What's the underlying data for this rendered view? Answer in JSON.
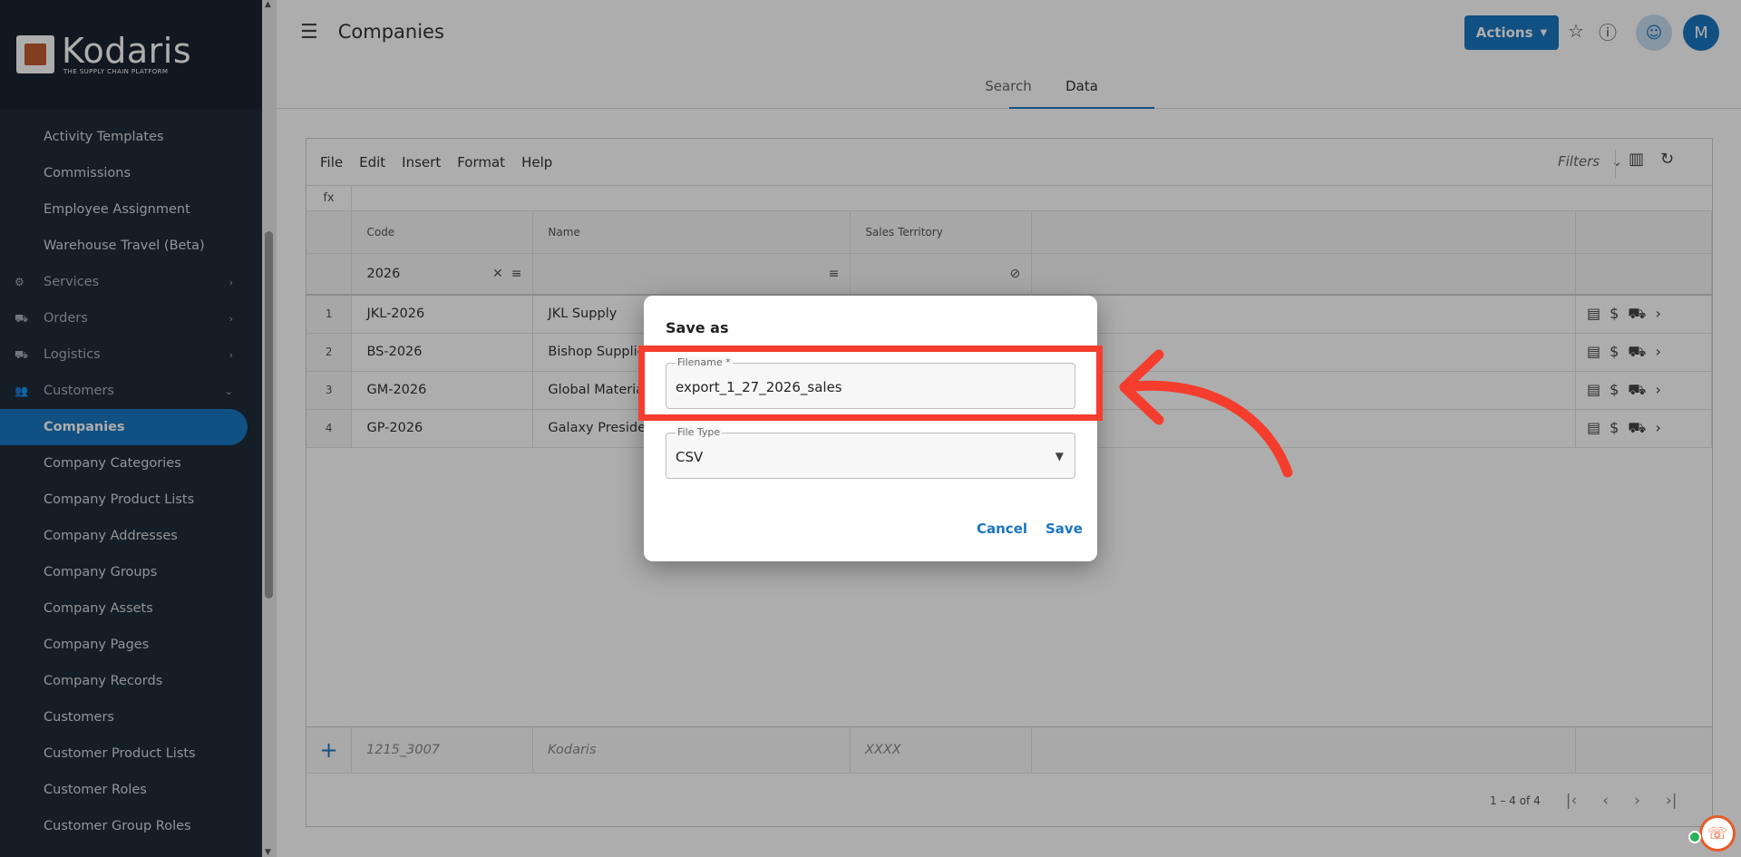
{
  "brand": {
    "name": "Kodaris",
    "tagline": "THE SUPPLY CHAIN PLATFORM"
  },
  "sidebar": {
    "items": [
      {
        "label": "Activity Templates",
        "type": "link"
      },
      {
        "label": "Commissions",
        "type": "link"
      },
      {
        "label": "Employee Assignment",
        "type": "link"
      },
      {
        "label": "Warehouse Travel (Beta)",
        "type": "link"
      },
      {
        "label": "Services",
        "type": "group",
        "icon": "gears-icon",
        "expanded": false
      },
      {
        "label": "Orders",
        "type": "group",
        "icon": "truck-icon",
        "expanded": false
      },
      {
        "label": "Logistics",
        "type": "group",
        "icon": "delivery-icon",
        "expanded": false
      },
      {
        "label": "Customers",
        "type": "group",
        "icon": "people-icon",
        "expanded": true
      },
      {
        "label": "Companies",
        "type": "link",
        "active": true
      },
      {
        "label": "Company Categories",
        "type": "link"
      },
      {
        "label": "Company Product Lists",
        "type": "link"
      },
      {
        "label": "Company Addresses",
        "type": "link"
      },
      {
        "label": "Company Groups",
        "type": "link"
      },
      {
        "label": "Company Assets",
        "type": "link"
      },
      {
        "label": "Company Pages",
        "type": "link"
      },
      {
        "label": "Company Records",
        "type": "link"
      },
      {
        "label": "Customers",
        "type": "link"
      },
      {
        "label": "Customer Product Lists",
        "type": "link"
      },
      {
        "label": "Customer Roles",
        "type": "link"
      },
      {
        "label": "Customer Group Roles",
        "type": "link"
      }
    ]
  },
  "header": {
    "title": "Companies",
    "actions_label": "Actions",
    "avatar_initial": "M"
  },
  "tabs": [
    {
      "label": "Search"
    },
    {
      "label": "Data",
      "active": true
    }
  ],
  "sheet": {
    "menu": [
      "File",
      "Edit",
      "Insert",
      "Format",
      "Help"
    ],
    "filters_label": "Filters",
    "fx_label": "fx",
    "columns": {
      "code": "Code",
      "name": "Name",
      "territory": "Sales Territory"
    },
    "filter_code": "2026",
    "rows": [
      {
        "n": "1",
        "code": "JKL-2026",
        "name": "JKL Supply"
      },
      {
        "n": "2",
        "code": "BS-2026",
        "name": "Bishop Supplies"
      },
      {
        "n": "3",
        "code": "GM-2026",
        "name": "Global Materials"
      },
      {
        "n": "4",
        "code": "GP-2026",
        "name": "Galaxy President"
      }
    ],
    "new_row": {
      "code": "1215_3007",
      "name": "Kodaris",
      "territory": "XXXX"
    },
    "pager": "1 – 4 of 4"
  },
  "dialog": {
    "title": "Save as",
    "filename_label": "Filename *",
    "filename_value": "export_1_27_2026_sales",
    "filetype_label": "File Type",
    "filetype_value": "CSV",
    "cancel_label": "Cancel",
    "save_label": "Save"
  },
  "colors": {
    "accent": "#1a76c0",
    "sidebar": "#202b38",
    "highlight": "#f53d2d"
  }
}
